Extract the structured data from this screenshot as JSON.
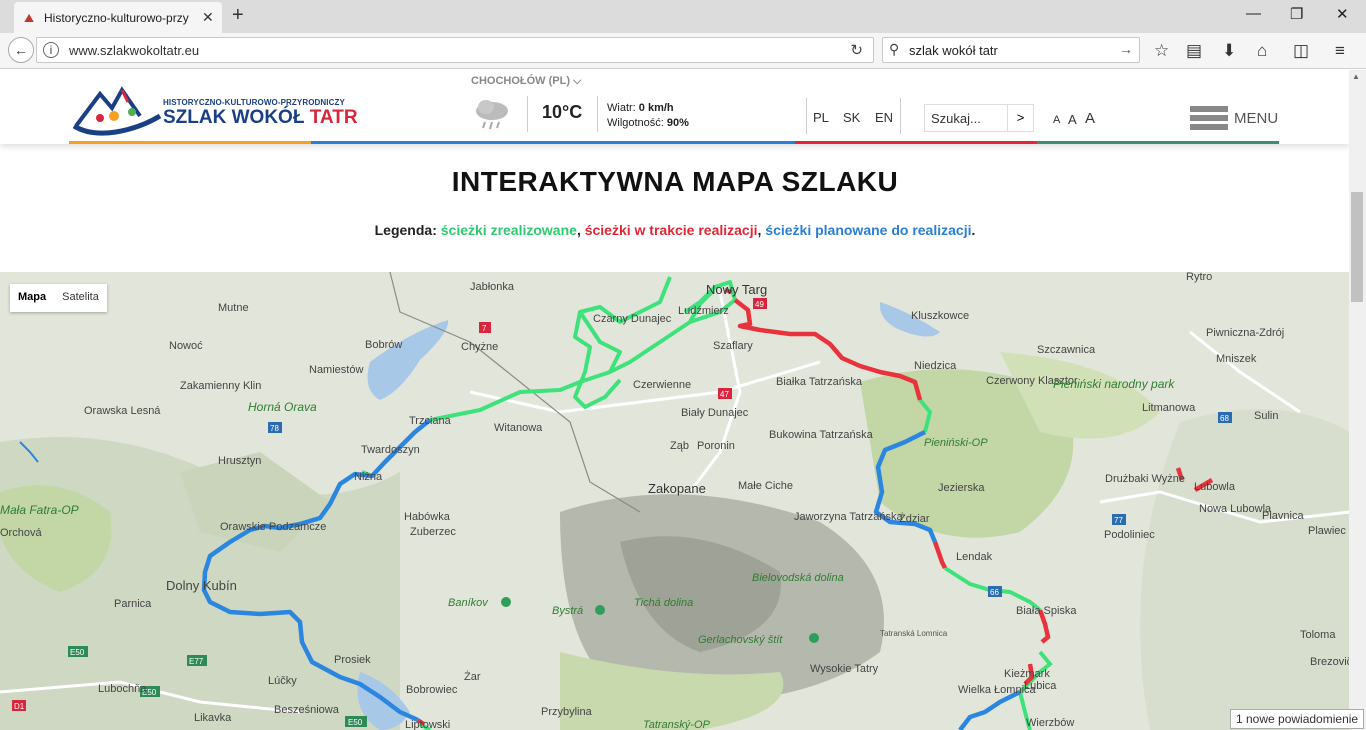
{
  "browser": {
    "tab_title": "Historyczno-kulturowo-przy",
    "new_tab": "+",
    "url": "www.szlakwokoltatr.eu",
    "search_query": "szlak wokół tatr"
  },
  "header": {
    "logo_small": "HISTORYCZNO-KULTUROWO-PRZYRODNICZY",
    "logo_big_1": "SZLAK WOKÓŁ",
    "logo_big_2": "TATR",
    "weather_location": "CHOCHOŁÓW (PL) ⌵",
    "temperature": "10°C",
    "wind_label": "Wiatr:",
    "wind_value": "0 km/h",
    "humidity_label": "Wilgotność:",
    "humidity_value": "90%",
    "languages": [
      "PL",
      "SK",
      "EN"
    ],
    "search_placeholder": "Szukaj...",
    "search_button": ">",
    "font_sizes": [
      "A",
      "A",
      "A"
    ],
    "menu_label": "MENU",
    "colors": [
      "#f5a020",
      "#2a7fd4",
      "#2a7fd4",
      "#e32636",
      "#4caf50",
      "#2e7d6b"
    ]
  },
  "main": {
    "title": "INTERAKTYWNA MAPA SZLAKU",
    "legend_label": "Legenda:",
    "legend_green": "ścieżki zrealizowane",
    "legend_red": "ścieżki w trakcie realizacji",
    "legend_blue": "ścieżki planowane do realizacji",
    "legend_comma1": ",",
    "legend_comma2": ",",
    "legend_dot": "."
  },
  "map": {
    "type_buttons": [
      "Mapa",
      "Satelita"
    ],
    "places": [
      {
        "name": "Jabłonka"
      },
      {
        "name": "Nowy Targ"
      },
      {
        "name": "Kluszkowce"
      },
      {
        "name": "Mutne"
      },
      {
        "name": "Czarny Dunajec"
      },
      {
        "name": "Ludźmierz"
      },
      {
        "name": "Szaflary"
      },
      {
        "name": "Rytro"
      },
      {
        "name": "Piwniczna-Zdrój"
      },
      {
        "name": "Nowoć"
      },
      {
        "name": "Bobrów"
      },
      {
        "name": "Chyżne"
      },
      {
        "name": "Niedzica"
      },
      {
        "name": "Szczawnica"
      },
      {
        "name": "Mniszek"
      },
      {
        "name": "Zakamienny Klin"
      },
      {
        "name": "Namiestów"
      },
      {
        "name": "Czerwienne"
      },
      {
        "name": "Białka Tatrzańska"
      },
      {
        "name": "Czerwony Klasztor"
      },
      {
        "name": "Pieniński narodny park"
      },
      {
        "name": "Orawska Lesná"
      },
      {
        "name": "Horná Orava"
      },
      {
        "name": "Trzciana"
      },
      {
        "name": "Witanowa"
      },
      {
        "name": "Biały Dunajec"
      },
      {
        "name": "Litmanowa"
      },
      {
        "name": "Sulin"
      },
      {
        "name": "Ząb"
      },
      {
        "name": "Poronin"
      },
      {
        "name": "Bukowina Tatrzańska"
      },
      {
        "name": "Pieniński-OP"
      },
      {
        "name": "Twardoszyn"
      },
      {
        "name": "Hrusztyn"
      },
      {
        "name": "Zakopane"
      },
      {
        "name": "Małe Ciche"
      },
      {
        "name": "Jezierska"
      },
      {
        "name": "Drużbaki Wyżne"
      },
      {
        "name": "Lubowla"
      },
      {
        "name": "Niżna"
      },
      {
        "name": "Mała Fatra-OP"
      },
      {
        "name": "Habówka"
      },
      {
        "name": "Zuberzec"
      },
      {
        "name": "Jaworzyna Tatrzańska"
      },
      {
        "name": "Żdziar"
      },
      {
        "name": "Nowa Lubowla"
      },
      {
        "name": "Plavnica"
      },
      {
        "name": "Orawskie Podzamcze"
      },
      {
        "name": "Lendak"
      },
      {
        "name": "Podoliniec"
      },
      {
        "name": "Plawiec"
      },
      {
        "name": "Dolny Kubín"
      },
      {
        "name": "Baníkov"
      },
      {
        "name": "Bystrá"
      },
      {
        "name": "Tichá dolina"
      },
      {
        "name": "Bielovodská dolina"
      },
      {
        "name": "Biała Spiska"
      },
      {
        "name": "Parnica"
      },
      {
        "name": "Gerlachovský štít"
      },
      {
        "name": "Tatranská Lomnica"
      },
      {
        "name": "Toloma"
      },
      {
        "name": "Prosiek"
      },
      {
        "name": "Wysokie Tatry"
      },
      {
        "name": "Kieżmark"
      },
      {
        "name": "Lubica"
      },
      {
        "name": "Brezovič"
      },
      {
        "name": "Lubochňa"
      },
      {
        "name": "Lúčky"
      },
      {
        "name": "Żar"
      },
      {
        "name": "Bobrowiec"
      },
      {
        "name": "Wielka Łomnica"
      },
      {
        "name": "Besześniowa"
      },
      {
        "name": "Likavka"
      },
      {
        "name": "Liptowski"
      },
      {
        "name": "Przybylina"
      },
      {
        "name": "Tatranský-OP"
      },
      {
        "name": "Wierzbów"
      },
      {
        "name": "Orchová"
      }
    ],
    "road_labels": [
      "7",
      "49",
      "47",
      "78",
      "68",
      "77",
      "66",
      "E77",
      "E50",
      "E50",
      "E50",
      "D1"
    ],
    "notification": "1 nowe powiadomienie"
  }
}
